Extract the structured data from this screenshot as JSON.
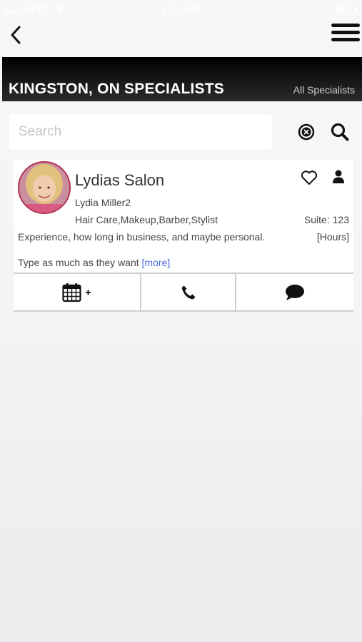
{
  "status_bar": {
    "carrier": "AT&T",
    "time": "2:32 PM"
  },
  "nav": {
    "back_icon": "chevron-left-icon",
    "menu_icon": "hamburger-menu-icon"
  },
  "banner": {
    "title": "KINGSTON, ON SPECIALISTS",
    "link": "All Specialists"
  },
  "search": {
    "placeholder": "Search",
    "value": ""
  },
  "specialist": {
    "name": "Lydias Salon",
    "owner": "Lydia Miller2",
    "services": "Hair Care,Makeup,Barber,Stylist",
    "suite": "Suite: 123",
    "description": "Experience, how long in business, and maybe personal.",
    "hours_link": "[Hours]",
    "extra_text": "Type as much as they want",
    "more_link": "[more]"
  },
  "actions": {
    "book_icon": "calendar-add-icon",
    "call_icon": "phone-icon",
    "message_icon": "chat-bubble-icon"
  },
  "colors": {
    "banner": "#000000",
    "link": "#4a6ad8",
    "background": "#f4f4f4"
  }
}
